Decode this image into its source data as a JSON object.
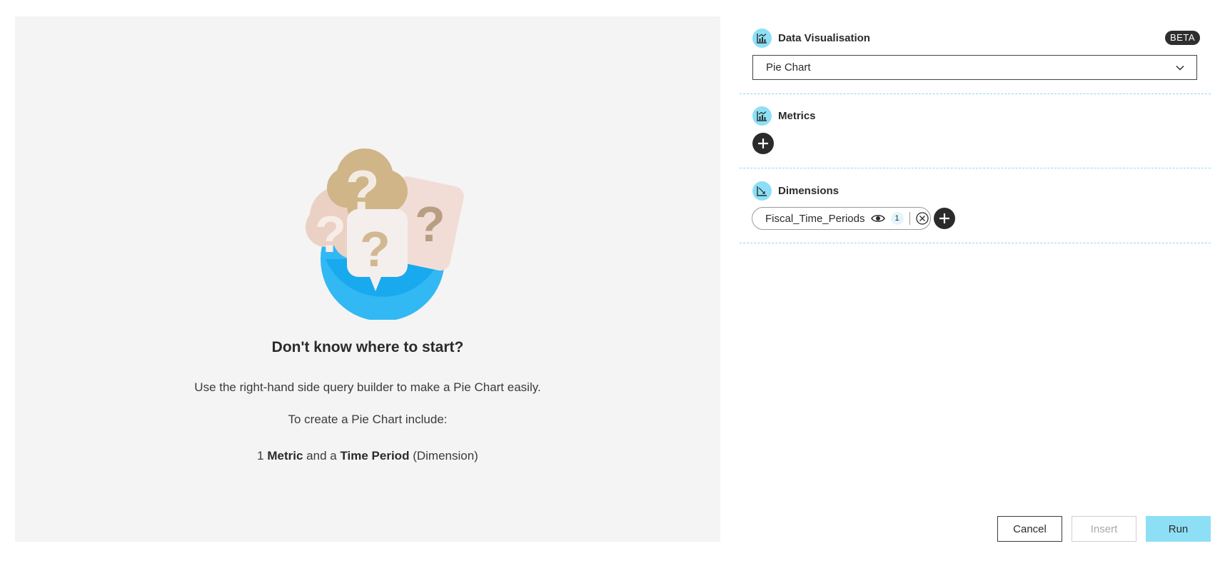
{
  "empty_state": {
    "title": "Don't know where to start?",
    "description": "Use the right-hand side query builder to make a Pie Chart easily.",
    "sub": "To create a Pie Chart include:",
    "req_count": "1",
    "req_metric": "Metric",
    "req_and": "and a",
    "req_time": "Time Period",
    "req_dimension": "(Dimension)"
  },
  "data_visualisation": {
    "title": "Data Visualisation",
    "badge": "BETA",
    "selected": "Pie Chart",
    "icon": "chart-icon"
  },
  "metrics": {
    "title": "Metrics",
    "icon": "chart-icon"
  },
  "dimensions": {
    "title": "Dimensions",
    "icon": "axis-icon",
    "chips": [
      {
        "label": "Fiscal_Time_Periods",
        "count": "1"
      }
    ]
  },
  "actions": {
    "cancel": "Cancel",
    "insert": "Insert",
    "run": "Run"
  },
  "colors": {
    "accent": "#8ddff5",
    "dark": "#2b2b2b",
    "panel": "#f4f4f4"
  }
}
